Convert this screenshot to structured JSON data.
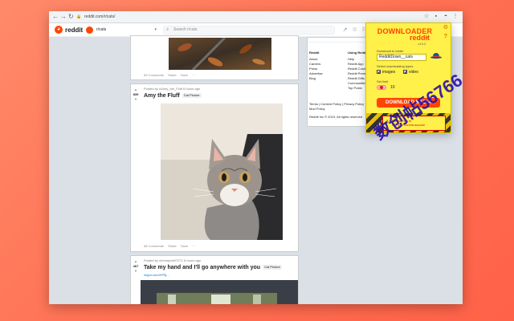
{
  "browser": {
    "url": "reddit.com/r/cats/",
    "back_glyph": "←",
    "forward_glyph": "→",
    "reload_glyph": "↻",
    "lock_glyph": "🔒",
    "star_glyph": "☆",
    "ext_glyph": "▪",
    "profile_glyph": "◓",
    "menu_glyph": "⋮"
  },
  "header": {
    "logo_glyph": "◕",
    "logo_text": "reddit",
    "subreddit": "r/cats",
    "chevron_glyph": "▾",
    "search_glyph": "⌕",
    "search_placeholder": "Search r/cats",
    "trending_glyph": "↗",
    "chat_glyph": "♲",
    "coin_glyph": "⚐",
    "avatar_glyph": "●"
  },
  "posts": [
    {
      "footer": {
        "comments": "59 Comments",
        "share": "Share",
        "save": "Save",
        "more": "···"
      }
    },
    {
      "votes": "839",
      "up_glyph": "▲",
      "down_glyph": "▼",
      "meta": "Posted by u/Amy_the_Fluff 6 hours ago",
      "title": "Amy the Fluff",
      "flair": "Cat Picture",
      "footer": {
        "comments": "58 Comments",
        "share": "Share",
        "save": "Save",
        "more": "···"
      }
    },
    {
      "votes": "467",
      "up_glyph": "▲",
      "down_glyph": "▼",
      "meta": "Posted by u/hmmpde07271 6 hours ago",
      "title": "Take my hand and I'll go anywhere with you",
      "flair": "Cat Picture",
      "link": "imgur.com/HP5j..."
    }
  ],
  "sidebar": {
    "col1_heading": "Reddit",
    "col1": [
      "About",
      "Careers",
      "Press",
      "Advertise",
      "Blog"
    ],
    "col2_heading": "Using Reddit",
    "col2": [
      "Help",
      "Reddit App",
      "Reddit Coins",
      "Reddit Premium",
      "Reddit Gifts",
      "Communities",
      "Top Posts"
    ],
    "legal_line1": "Terms  |  Content Policy  |  Privacy Policy",
    "legal_line2": "Mod Policy",
    "copyright": "Reddit Inc © 2019. All rights reserved"
  },
  "extension": {
    "title_downloader": "DOWNLOADER",
    "title_for": "for",
    "title_reddit": "reddit",
    "version": "v1.0.2",
    "gear_glyph": "⚙",
    "help_glyph": "?",
    "folder_label": "Download to folder",
    "folder_value": "RedditDown__cats",
    "types_label": "Select downloading types",
    "images_label": "images",
    "video_label": "video",
    "limit_label": "Set limit",
    "limit_value": "10",
    "download_button": "DOWNLOAD MEDIA",
    "warn_glyph": "⚠",
    "warn_line1": "Please, log in",
    "warn_line2": "Use your Chrome account"
  },
  "watermark": {
    "text": "数创帖56766"
  },
  "colors": {
    "reddit_orange": "#ff4500",
    "extension_yellow": "#fff04a",
    "background": "#ff7155"
  }
}
